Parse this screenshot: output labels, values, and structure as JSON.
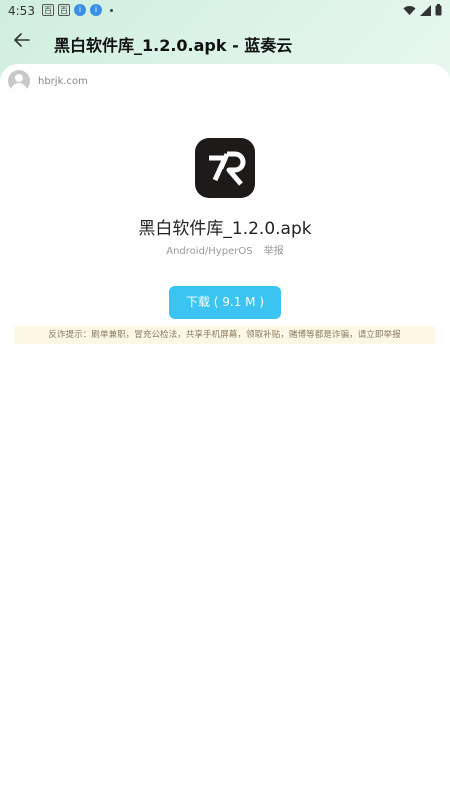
{
  "status": {
    "time": "4:53",
    "left_icons": [
      "百",
      "百"
    ],
    "notification_icons": [
      "i",
      "i"
    ],
    "colors": {
      "notification": "#3a8ee6"
    }
  },
  "header": {
    "title": "黑白软件库_1.2.0.apk - 蓝奏云",
    "back_icon": "arrow-left-icon"
  },
  "uploader": {
    "name": "hbrjk.com",
    "avatar_icon": "person-icon"
  },
  "file": {
    "icon": "app-logo-icon",
    "name": "黑白软件库_1.2.0.apk",
    "platform": "Android/HyperOS",
    "report_label": "举报"
  },
  "download": {
    "label": "下载 ( 9.1 M )",
    "color": "#3bc4f2"
  },
  "warning": {
    "text": "反诈提示：刷单兼职，冒充公检法，共享手机屏幕，领取补贴，赌博等都是诈骗，请立即举报"
  }
}
